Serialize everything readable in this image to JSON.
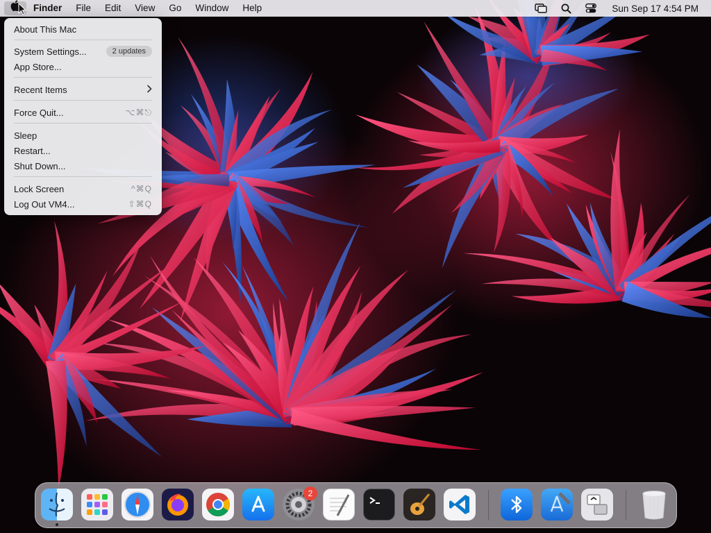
{
  "menubar": {
    "apple_icon": "apple-logo-icon",
    "app_name": "Finder",
    "menus": [
      "File",
      "Edit",
      "View",
      "Go",
      "Window",
      "Help"
    ],
    "status_icons": [
      "screen-mirroring-icon",
      "spotlight-search-icon",
      "control-center-icon"
    ],
    "clock": "Sun Sep 17  4:54 PM"
  },
  "apple_menu": {
    "items": [
      {
        "label": "About This Mac"
      },
      {
        "label": "System Settings...",
        "badge": "2 updates"
      },
      {
        "label": "App Store..."
      },
      {
        "label": "Recent Items",
        "submenu_icon": "chevron-right-icon"
      },
      {
        "label": "Force Quit...",
        "shortcut": "⌥⌘⎋"
      },
      {
        "label": "Sleep"
      },
      {
        "label": "Restart..."
      },
      {
        "label": "Shut Down..."
      },
      {
        "label": "Lock Screen",
        "shortcut": "^⌘Q"
      },
      {
        "label": "Log Out VM4...",
        "shortcut": "⇧⌘Q"
      }
    ]
  },
  "dock": {
    "apps": [
      {
        "name": "finder-icon",
        "running": true
      },
      {
        "name": "launchpad-icon"
      },
      {
        "name": "safari-icon"
      },
      {
        "name": "firefox-icon"
      },
      {
        "name": "chrome-icon"
      },
      {
        "name": "app-store-icon"
      },
      {
        "name": "system-settings-icon",
        "badge": "2"
      },
      {
        "name": "textedit-icon"
      },
      {
        "name": "terminal-icon"
      },
      {
        "name": "garageband-icon"
      },
      {
        "name": "vscode-icon"
      },
      {
        "name": "bluetooth-file-exchange-icon"
      },
      {
        "name": "xcode-icon"
      },
      {
        "name": "migration-assistant-icon"
      },
      {
        "name": "trash-icon"
      }
    ]
  },
  "colors": {
    "wallpaper_base": "#0a0406",
    "wallpaper_red": "#e0103c",
    "wallpaper_blue": "#2a6ad0",
    "badge_red": "#e9453a"
  }
}
